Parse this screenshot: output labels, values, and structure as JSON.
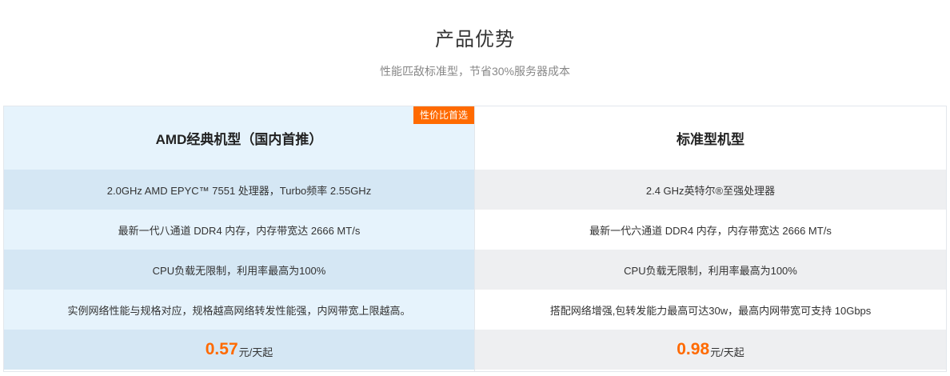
{
  "header": {
    "title": "产品优势",
    "subtitle": "性能匹敌标准型，节省30%服务器成本"
  },
  "columns": [
    {
      "badge": "性价比首选",
      "name": "AMD经典机型（国内首推）",
      "features": [
        "2.0GHz AMD EPYC™ 7551 处理器，Turbo频率 2.55GHz",
        "最新一代八通道 DDR4 内存，内存带宽达 2666 MT/s",
        "CPU负载无限制，利用率最高为100%",
        "实例网络性能与规格对应，规格越高网络转发性能强，内网带宽上限越高。"
      ],
      "price": "0.57",
      "price_unit": "元/天起"
    },
    {
      "name": "标准型机型",
      "features": [
        "2.4 GHz英特尔®至强处理器",
        "最新一代六通道 DDR4 内存，内存带宽达 2666 MT/s",
        "CPU负载无限制，利用率最高为100%",
        "搭配网络增强,包转发能力最高可达30w，最高内网带宽可支持 10Gbps"
      ],
      "price": "0.98",
      "price_unit": "元/天起"
    }
  ],
  "colors": {
    "accent": "#ff6a00",
    "left_header_bg": "#e6f3fc",
    "left_row_dark": "#d5e7f4",
    "right_row_dark": "#eeeff1"
  }
}
